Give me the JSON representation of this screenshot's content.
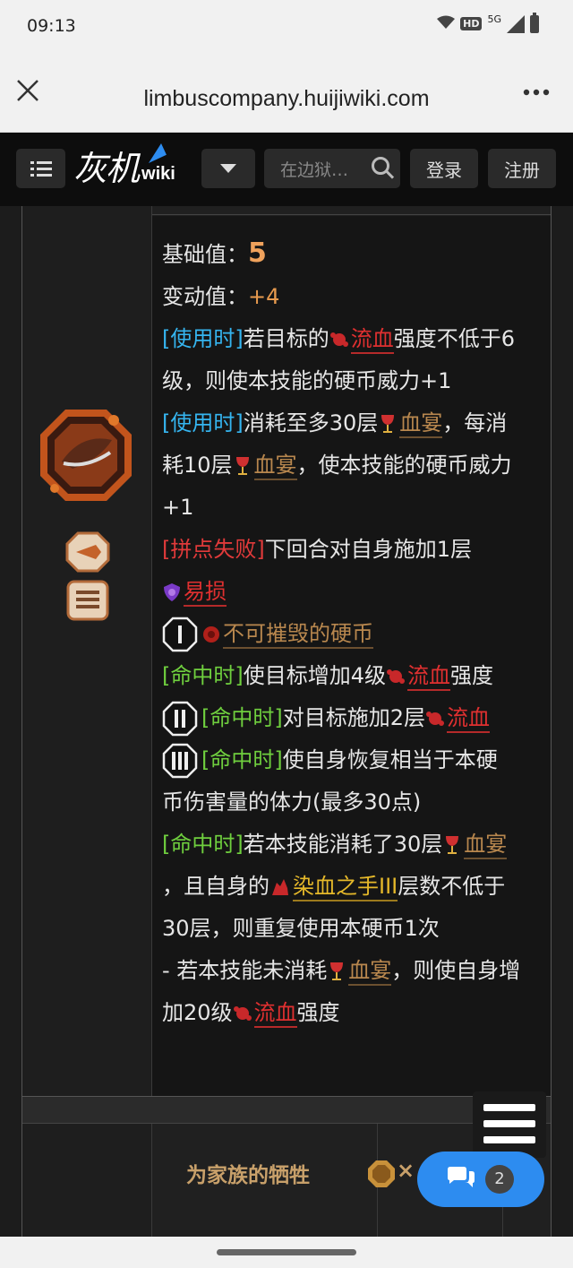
{
  "status": {
    "time": "09:13",
    "network": "5G",
    "hd": "HD"
  },
  "browser": {
    "url": "limbuscompany.huijiwiki.com",
    "close_icon": "close-icon",
    "more_icon": "more-vert-icon"
  },
  "site": {
    "logo_cn": "灰机",
    "logo_wiki": "wiki",
    "search_placeholder": "在边狱…",
    "login": "登录",
    "register": "注册"
  },
  "skill": {
    "base_label": "基础值：",
    "base_value": "5",
    "var_label": "变动值：",
    "var_value": "+4",
    "lines": {
      "l1_tag": "[使用时]",
      "l1_pre": "若目标的",
      "l1_kw": "流血",
      "l1_post": "强度不低于6",
      "l2": "级，则使本技能的硬币威力+1",
      "l3_tag": "[使用时]",
      "l3_pre": "消耗至多30层",
      "l3_kw": "血宴",
      "l3_post": "，每消",
      "l4_pre": "耗10层",
      "l4_kw": "血宴",
      "l4_post": "，使本技能的硬币威力",
      "l5": "+1",
      "l6_tag": "[拼点失败]",
      "l6_post": "下回合对自身施加1层",
      "l7_kw": "易损",
      "l8_kw": "不可摧毁的硬币",
      "l9_tag": "[命中时]",
      "l9_pre": "使目标增加4级",
      "l9_kw": "流血",
      "l9_post": "强度",
      "l10_tag": "[命中时]",
      "l10_pre": "对目标施加2层",
      "l10_kw": "流血",
      "l11_tag": "[命中时]",
      "l11_post": "使自身恢复相当于本硬",
      "l12": "币伤害量的体力(最多30点)",
      "l13_tag": "[命中时]",
      "l13_pre": "若本技能消耗了30层",
      "l13_kw": "血宴",
      "l14_pre": "，且自身的",
      "l14_kw": "染血之手III",
      "l14_post": "层数不低于",
      "l15": "30层，则重复使用本硬币1次",
      "l16_pre": "- 若本技能未消耗",
      "l16_kw": "血宴",
      "l16_post": "，则使自身增",
      "l17_pre": "加20级",
      "l17_kw": "流血",
      "l17_post": "强度"
    },
    "coin_labels": {
      "c1": "I",
      "c2": "II",
      "c3": "III"
    }
  },
  "next_skill": {
    "title": "为家族的牺牲",
    "times": "×"
  },
  "chat": {
    "count": "2"
  },
  "colors": {
    "use": "#35b5f0",
    "fail": "#e03a3a",
    "hit": "#6fcf3e",
    "accent": "#2d8cf0"
  }
}
